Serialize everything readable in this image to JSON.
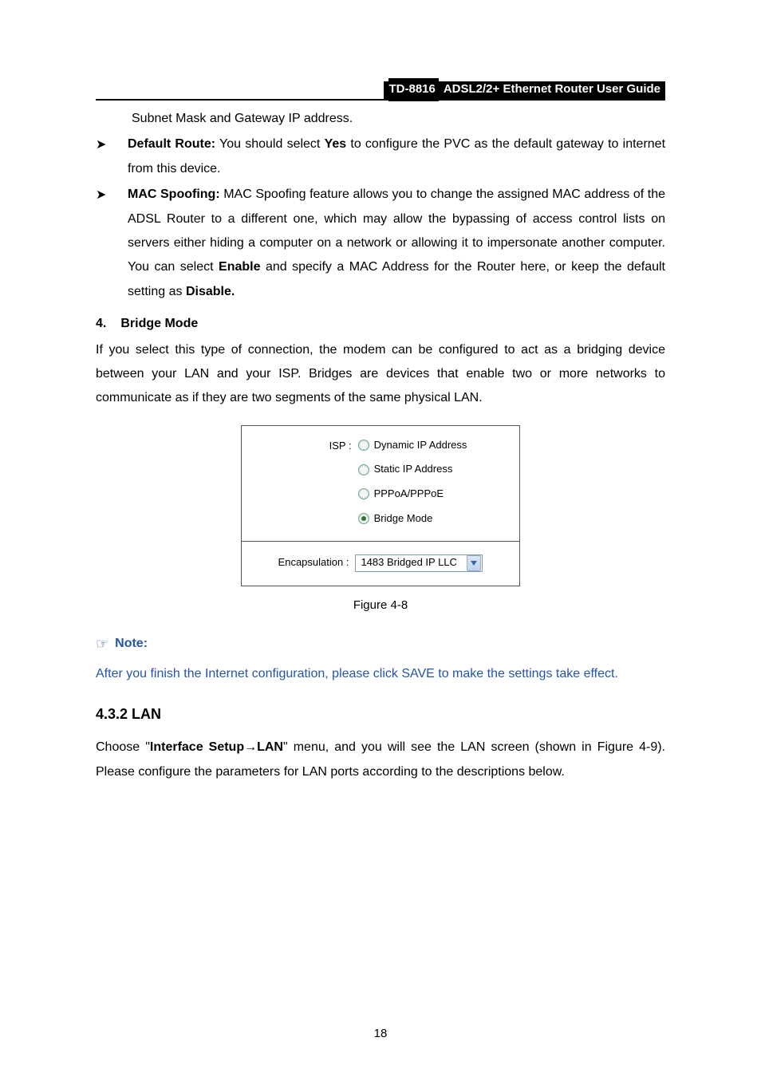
{
  "header": {
    "model": "TD-8816",
    "subtitle": "ADSL2/2+ Ethernet Router User Guide"
  },
  "content": {
    "subnet_line": "Subnet Mask and Gateway IP address.",
    "bullets": [
      {
        "strong": "Default Route:",
        "text": " You should select Yes to configure the PVC as the default gateway to internet from this device."
      },
      {
        "strong": "MAC Spoofing:",
        "text": " MAC Spoofing feature allows you to change the assigned MAC address of the ADSL Router to a different one, which may allow the bypassing of access control lists on servers either hiding a computer on a network or allowing it to impersonate another computer. You can select Enable and specify a MAC Address for the Router here, or keep the default setting as Disable."
      }
    ],
    "section4": {
      "num": "4.",
      "title": "Bridge Mode"
    },
    "bridge_para": "If you select this type of connection, the modem can be configured to act as a bridging device between your LAN and your ISP. Bridges are devices that enable two or more networks to communicate as if they are two segments of the same physical LAN.",
    "figure": {
      "isp_label": "ISP :",
      "options": [
        {
          "label": "Dynamic IP Address",
          "selected": false
        },
        {
          "label": "Static IP Address",
          "selected": false
        },
        {
          "label": "PPPoA/PPPoE",
          "selected": false
        },
        {
          "label": "Bridge Mode",
          "selected": true
        }
      ],
      "encap_label": "Encapsulation :",
      "encap_value": "1483 Bridged IP LLC",
      "caption": "Figure 4-8"
    },
    "note_label": "Note:",
    "note_body": "After you finish the Internet configuration, please click SAVE to make the settings take effect.",
    "h432": "4.3.2  LAN",
    "lan_para_before": "Choose \"",
    "lan_para_bold1": "Interface Setup",
    "lan_para_arrow": "→",
    "lan_para_bold2": "LAN",
    "lan_para_after": "\" menu, and you will see the LAN screen (shown in Figure 4-9). Please configure the parameters for LAN ports according to the descriptions below.",
    "page_num": "18"
  }
}
